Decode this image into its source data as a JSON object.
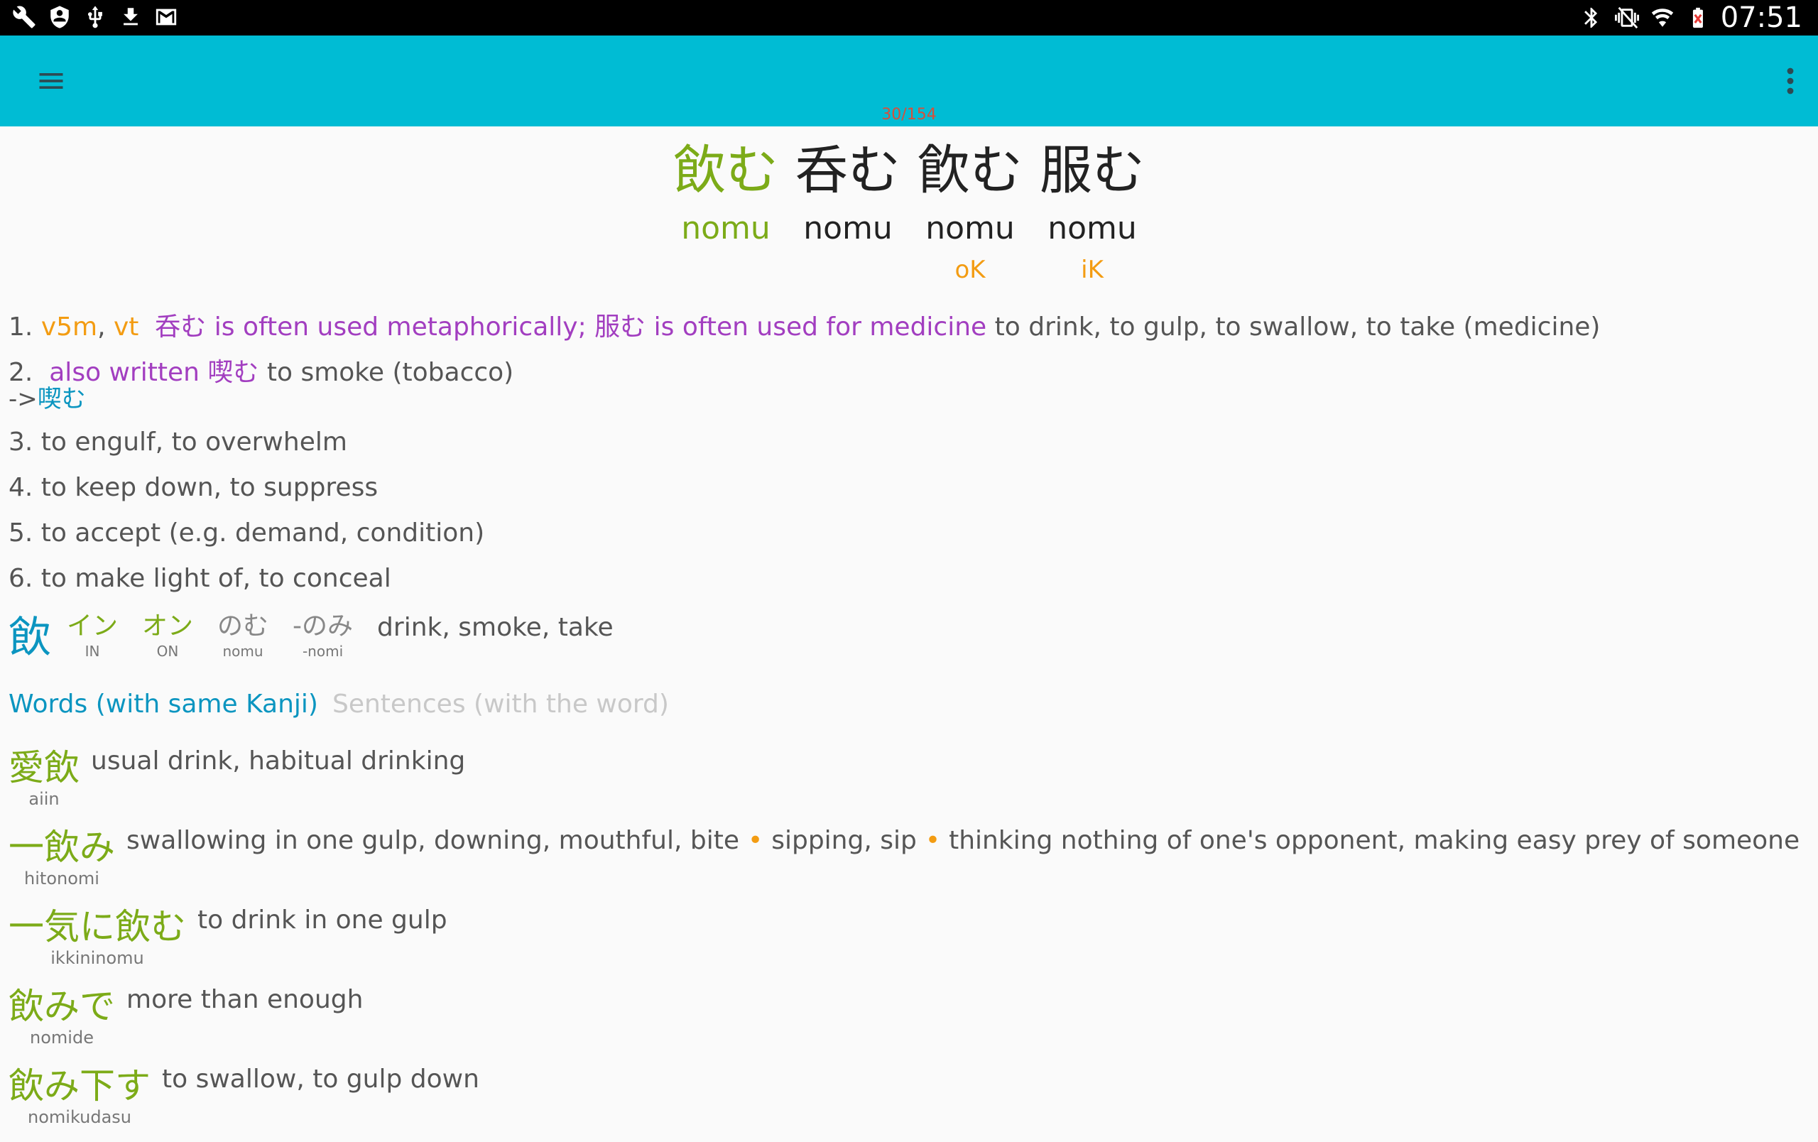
{
  "status_bar": {
    "time": "07:51",
    "left_icons": [
      "wrench-icon",
      "shield-icon",
      "usb-icon",
      "download-icon",
      "gmail-icon"
    ],
    "right_icons": [
      "bluetooth-icon",
      "vibrate-icon",
      "wifi-icon",
      "battery-icon"
    ]
  },
  "toolbar": {
    "menu_icon": "hamburger-menu-icon",
    "overflow_icon": "overflow-menu-icon",
    "page_counter": "30/154",
    "background": "#00bcd4"
  },
  "headwords": [
    {
      "kanji": "飲む",
      "kana": "nomu",
      "tag": ""
    },
    {
      "kanji": "呑む",
      "kana": "nomu",
      "tag": ""
    },
    {
      "kanji": "飮む",
      "kana": "nomu",
      "tag": "oK"
    },
    {
      "kanji": "服む",
      "kana": "nomu",
      "tag": "iK"
    }
  ],
  "senses": {
    "s1": {
      "num": "1.",
      "pos1": "v5m",
      "comma": ", ",
      "pos2": "vt",
      "note": "呑む is often used metaphorically; 服む is often used for medicine",
      "gloss": "to drink, to gulp, to swallow, to take (medicine)"
    },
    "s2": {
      "num": "2.",
      "note": "also written 喫む",
      "gloss": "to smoke (tobacco)",
      "xref_arrow": "->",
      "xref": "喫む"
    },
    "s3": "3. to engulf, to overwhelm",
    "s4": "4. to keep down, to suppress",
    "s5": "5. to accept (e.g. demand, condition)",
    "s6": "6. to make light of, to conceal"
  },
  "kanji_info": {
    "kanji": "飲",
    "readings": [
      {
        "kana": "イン",
        "romaji": "IN"
      },
      {
        "kana": "オン",
        "romaji": "ON"
      },
      {
        "kana": "のむ",
        "romaji": "nomu"
      },
      {
        "kana": "-のみ",
        "romaji": "-nomi"
      }
    ],
    "meaning": "drink, smoke, take"
  },
  "tabs": {
    "words": "Words (with same Kanji)",
    "sentences": "Sentences (with the word)"
  },
  "words": [
    {
      "kanji": "愛飲",
      "romaji": "aiin",
      "meanings": [
        "usual drink, habitual drinking"
      ]
    },
    {
      "kanji": "一飲み",
      "romaji": "hitonomi",
      "meanings": [
        "swallowing in one gulp, downing, mouthful, bite",
        "sipping, sip",
        "thinking nothing of one's opponent, making easy prey of someone"
      ]
    },
    {
      "kanji": "一気に飲む",
      "romaji": "ikkininomu",
      "meanings": [
        "to drink in one gulp"
      ]
    },
    {
      "kanji": "飲みで",
      "romaji": "nomide",
      "meanings": [
        "more than enough"
      ]
    },
    {
      "kanji": "飲み下す",
      "romaji": "nomikudasu",
      "meanings": [
        "to swallow, to gulp down"
      ]
    }
  ],
  "separator": "•",
  "colors": {
    "accent_green": "#7cab18",
    "accent_blue": "#0b95c0",
    "pos_orange": "#f39c12",
    "note_purple": "#a23ec0",
    "counter_red": "#d84f3a"
  }
}
